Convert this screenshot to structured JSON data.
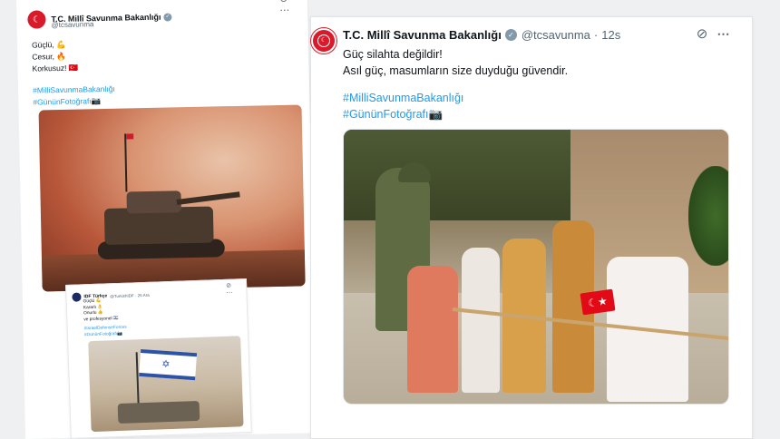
{
  "left_tweet": {
    "account_name": "T.C. Millî Savunma Bakanlığı",
    "handle": "@tcsavunma",
    "icons": "⊘ ⋯",
    "lines": [
      "Güçlü, 💪",
      "Cesur, 🔥",
      "Korkusuz! 🇹🇷"
    ],
    "hashtags": [
      "#MilliSavunmaBakanlığı",
      "#GününFotoğrafı📷"
    ]
  },
  "inset_tweet": {
    "account_name": "IDF Türkçe",
    "handle": "@TurkishIDF · 26 Ara",
    "icons": "⊘ ⋯",
    "lines": [
      "Güçlü 💪",
      "Kararlı 👌",
      "Onurlu 👍",
      "ve profesyonel 🇮🇱"
    ],
    "hashtags": [
      "#IsraelDefenseForces",
      "#GününFotoğrafı📷"
    ]
  },
  "right_tweet": {
    "account_name": "T.C. Millî Savunma Bakanlığı",
    "handle": "@tcsavunma",
    "separator": "·",
    "time": "12s",
    "grok_icon": "⊘",
    "more_icon": "⋯",
    "lines": [
      "Güç silahta değildir!",
      "Asıl güç, masumların size duyduğu güvendir."
    ],
    "hashtags": [
      "#MilliSavunmaBakanlığı",
      "#GününFotoğrafı📷"
    ]
  },
  "colors": {
    "link": "#1d9bf0",
    "text": "#0f1419",
    "muted": "#536471",
    "brand_red": "#d91a2a"
  }
}
